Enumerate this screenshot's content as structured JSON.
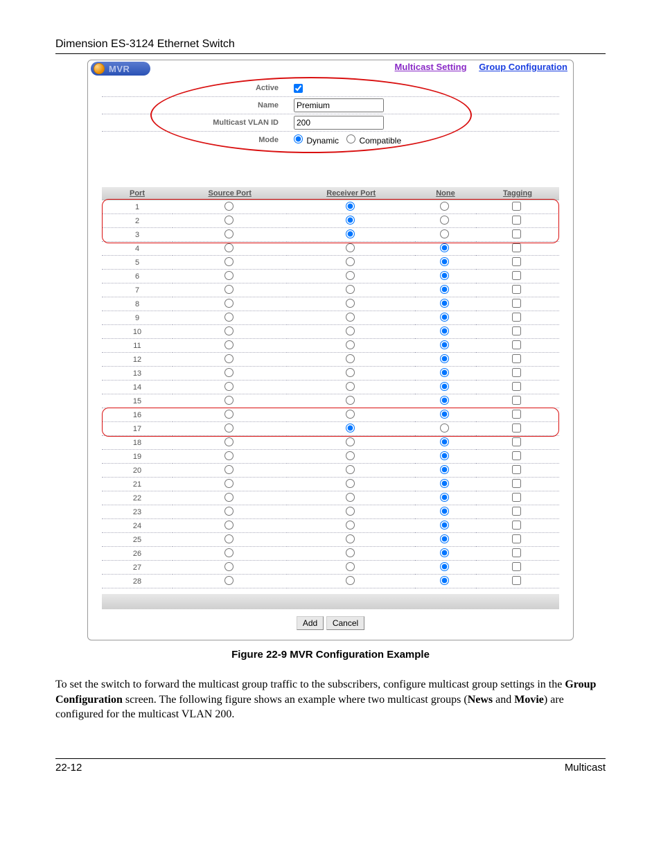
{
  "doc": {
    "header": "Dimension ES-3124 Ethernet Switch",
    "caption": "Figure 22-9 MVR Configuration Example",
    "paragraph_pre": "To set the switch to forward the multicast group traffic to the subscribers, configure multicast group settings in the ",
    "paragraph_b1": "Group Configuration",
    "paragraph_mid1": " screen. The following figure shows an example where two multicast groups (",
    "paragraph_b2": "News",
    "paragraph_mid2": " and ",
    "paragraph_b3": "Movie",
    "paragraph_post": ") are configured for the multicast VLAN 200.",
    "footer_left": "22-12",
    "footer_right": "Multicast"
  },
  "panel": {
    "title": "MVR",
    "links": {
      "multicast": "Multicast Setting",
      "group": "Group Configuration"
    }
  },
  "settings": {
    "active": {
      "label": "Active",
      "checked": true
    },
    "name": {
      "label": "Name",
      "value": "Premium"
    },
    "vlan": {
      "label": "Multicast VLAN ID",
      "value": "200"
    },
    "mode": {
      "label": "Mode",
      "opt1": "Dynamic",
      "opt2": "Compatible",
      "selected": "Dynamic"
    }
  },
  "table": {
    "headers": {
      "port": "Port",
      "source": "Source Port",
      "receiver": "Receiver Port",
      "none": "None",
      "tagging": "Tagging"
    },
    "rows": [
      {
        "port": 1,
        "sel": "receiver",
        "tag": false
      },
      {
        "port": 2,
        "sel": "receiver",
        "tag": false
      },
      {
        "port": 3,
        "sel": "receiver",
        "tag": false
      },
      {
        "port": 4,
        "sel": "none",
        "tag": false
      },
      {
        "port": 5,
        "sel": "none",
        "tag": false
      },
      {
        "port": 6,
        "sel": "none",
        "tag": false
      },
      {
        "port": 7,
        "sel": "none",
        "tag": false
      },
      {
        "port": 8,
        "sel": "none",
        "tag": false
      },
      {
        "port": 9,
        "sel": "none",
        "tag": false
      },
      {
        "port": 10,
        "sel": "none",
        "tag": false
      },
      {
        "port": 11,
        "sel": "none",
        "tag": false
      },
      {
        "port": 12,
        "sel": "none",
        "tag": false
      },
      {
        "port": 13,
        "sel": "none",
        "tag": false
      },
      {
        "port": 14,
        "sel": "none",
        "tag": false
      },
      {
        "port": 15,
        "sel": "none",
        "tag": false
      },
      {
        "port": 16,
        "sel": "none",
        "tag": false
      },
      {
        "port": 17,
        "sel": "receiver",
        "tag": false
      },
      {
        "port": 18,
        "sel": "none",
        "tag": false
      },
      {
        "port": 19,
        "sel": "none",
        "tag": false
      },
      {
        "port": 20,
        "sel": "none",
        "tag": false
      },
      {
        "port": 21,
        "sel": "none",
        "tag": false
      },
      {
        "port": 22,
        "sel": "none",
        "tag": false
      },
      {
        "port": 23,
        "sel": "none",
        "tag": false
      },
      {
        "port": 24,
        "sel": "none",
        "tag": false
      },
      {
        "port": 25,
        "sel": "none",
        "tag": false
      },
      {
        "port": 26,
        "sel": "none",
        "tag": false
      },
      {
        "port": 27,
        "sel": "none",
        "tag": false
      },
      {
        "port": 28,
        "sel": "none",
        "tag": false
      }
    ]
  },
  "buttons": {
    "add": "Add",
    "cancel": "Cancel"
  }
}
